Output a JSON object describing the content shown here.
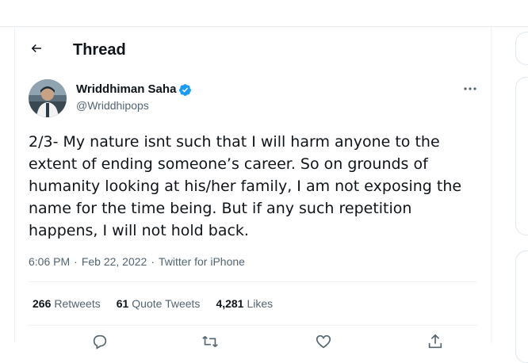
{
  "header": {
    "back_icon": "arrow-left-icon",
    "title": "Thread"
  },
  "tweet": {
    "author": {
      "display_name": "Wriddhiman Saha",
      "handle": "@Wriddhipops",
      "verified_icon": "verified-badge-icon",
      "avatar_icon": "avatar-photo"
    },
    "more_icon": "more-horizontal-icon",
    "text": "2/3- My nature isnt such that I will harm anyone to the extent of ending someone’s career. So on grounds of humanity looking at his/her family, I am not exposing the name for the time being. But if any such repetition happens, I will not hold back.",
    "time": "6:06 PM",
    "date": "Feb 22, 2022",
    "separator": "·",
    "source": "Twitter for iPhone",
    "stats": {
      "retweets": {
        "count": "266",
        "label": "Retweets"
      },
      "quotes": {
        "count": "61",
        "label": "Quote Tweets"
      },
      "likes": {
        "count": "4,281",
        "label": "Likes"
      }
    },
    "actions": {
      "reply_icon": "reply-icon",
      "retweet_icon": "retweet-icon",
      "like_icon": "heart-icon",
      "share_icon": "share-icon"
    }
  },
  "colors": {
    "primary_text": "#0f1419",
    "secondary_text": "#536471",
    "verified": "#1d9bf0",
    "divider": "#eff3f4"
  }
}
